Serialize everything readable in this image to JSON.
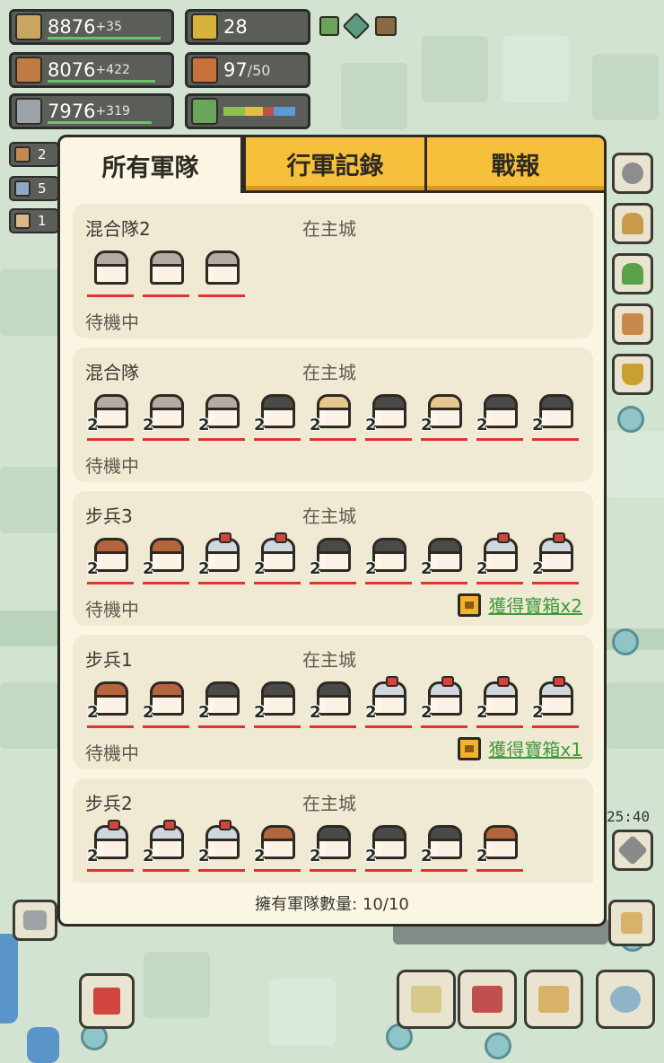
{
  "resources": [
    {
      "id": "wheat",
      "value": "8876",
      "plus": "+35",
      "icon": "wheat-icon"
    },
    {
      "id": "wood",
      "value": "8076",
      "plus": "+422",
      "icon": "wood-log-icon"
    },
    {
      "id": "stone",
      "value": "7976",
      "plus": "+319",
      "icon": "stone-icon"
    }
  ],
  "coins": {
    "value": "28",
    "icon": "coin-icon"
  },
  "population": {
    "value": "97",
    "cap": "/50",
    "icon": "gift-box-icon"
  },
  "side_chips": [
    "2",
    "5",
    "1"
  ],
  "clock": "25:40",
  "modal": {
    "tabs": [
      "所有軍隊",
      "行軍記錄",
      "戰報"
    ],
    "army_count_label": "擁有軍隊數量:",
    "army_count_value": "10/10",
    "cards": [
      {
        "name": "混合隊2",
        "location": "在主城",
        "status": "待機中",
        "reward": null,
        "units": [
          {
            "type": "gray",
            "level": ""
          },
          {
            "type": "gray",
            "level": ""
          },
          {
            "type": "gray",
            "level": ""
          }
        ]
      },
      {
        "name": "混合隊",
        "location": "在主城",
        "status": "待機中",
        "reward": null,
        "units": [
          {
            "type": "gray",
            "level": "2"
          },
          {
            "type": "gray",
            "level": "2"
          },
          {
            "type": "gray",
            "level": "2"
          },
          {
            "type": "dark",
            "level": "2"
          },
          {
            "type": "blond",
            "level": "2"
          },
          {
            "type": "dark",
            "level": "2"
          },
          {
            "type": "blond",
            "level": "2"
          },
          {
            "type": "dark",
            "level": "2"
          },
          {
            "type": "dark",
            "level": "2"
          }
        ]
      },
      {
        "name": "步兵3",
        "location": "在主城",
        "status": "待機中",
        "reward": "獲得寶箱x2",
        "units": [
          {
            "type": "brown",
            "level": "2"
          },
          {
            "type": "brown",
            "level": "2"
          },
          {
            "type": "helm",
            "level": "2"
          },
          {
            "type": "helm",
            "level": "2"
          },
          {
            "type": "dark",
            "level": "2"
          },
          {
            "type": "dark",
            "level": "2"
          },
          {
            "type": "dark",
            "level": "2"
          },
          {
            "type": "helm",
            "level": "2"
          },
          {
            "type": "helm",
            "level": "2"
          }
        ]
      },
      {
        "name": "步兵1",
        "location": "在主城",
        "status": "待機中",
        "reward": "獲得寶箱x1",
        "units": [
          {
            "type": "brown",
            "level": "2"
          },
          {
            "type": "brown",
            "level": "2"
          },
          {
            "type": "dark",
            "level": "2"
          },
          {
            "type": "dark",
            "level": "2"
          },
          {
            "type": "dark",
            "level": "2"
          },
          {
            "type": "helm",
            "level": "2"
          },
          {
            "type": "helm",
            "level": "2"
          },
          {
            "type": "helm",
            "level": "2"
          },
          {
            "type": "helm",
            "level": "2"
          }
        ]
      },
      {
        "name": "步兵2",
        "location": "在主城",
        "status": "",
        "reward": null,
        "units": [
          {
            "type": "helm",
            "level": "2"
          },
          {
            "type": "helm",
            "level": "2"
          },
          {
            "type": "helm",
            "level": "2"
          },
          {
            "type": "brown",
            "level": "2"
          },
          {
            "type": "dark",
            "level": "2"
          },
          {
            "type": "dark",
            "level": "2"
          },
          {
            "type": "dark",
            "level": "2"
          },
          {
            "type": "brown",
            "level": "2"
          }
        ]
      }
    ]
  },
  "colors": {
    "tab_inactive": "#f6c03c",
    "panel_bg": "#fbf6e4",
    "card_bg": "#f0ead4",
    "reward_green": "#3f9a3a",
    "hp_red": "#e0332f"
  }
}
